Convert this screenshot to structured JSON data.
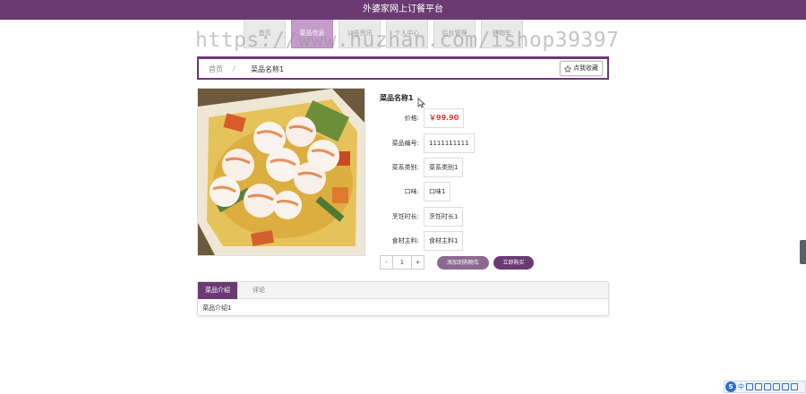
{
  "header": {
    "title": "外婆家网上订餐平台"
  },
  "nav": {
    "items": [
      "首页",
      "菜品信息",
      "公告资讯",
      "个人中心",
      "后台管理",
      "购物车"
    ],
    "active_index": 1
  },
  "watermark": "https://www.huzhan.com/ishop39397",
  "breadcrumb": {
    "home": "首页",
    "separator": "/",
    "current": "菜品名称1"
  },
  "favorite": {
    "icon": "star-outline-icon",
    "label": "点我收藏"
  },
  "product": {
    "name": "菜品名称1",
    "image": "shrimp-dish-photo",
    "attributes": [
      {
        "label": "价格:",
        "value": "￥99.90",
        "is_price": true
      },
      {
        "label": "菜品编号:",
        "value": "1111111111"
      },
      {
        "label": "菜系类别:",
        "value": "菜系类别1"
      },
      {
        "label": "口味:",
        "value": "口味1"
      },
      {
        "label": "烹饪时长:",
        "value": "烹饪时长1"
      },
      {
        "label": "食材主料:",
        "value": "食材主料1"
      }
    ]
  },
  "purchase": {
    "minus": "-",
    "quantity": "1",
    "plus": "+",
    "add_to_cart": "添加到购物车",
    "buy_now": "立即购买"
  },
  "tabs": {
    "items": [
      "菜品介绍",
      "评论"
    ],
    "active_index": 0,
    "content": "菜品介绍1"
  },
  "ime_toolbar": {
    "logo": "S",
    "mode": "中"
  },
  "colors": {
    "brand": "#6b3a73",
    "nav_active": "#c39cc9",
    "price": "#e4393c",
    "cart_button": "#8a6b8f"
  }
}
